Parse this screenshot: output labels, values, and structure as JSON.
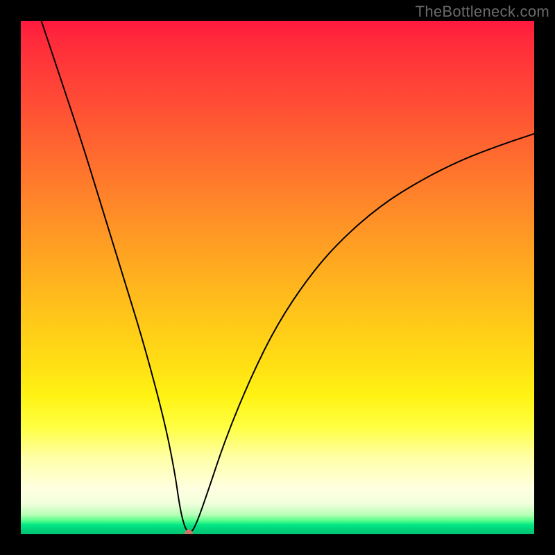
{
  "watermark": "TheBottleneck.com",
  "chart_data": {
    "type": "line",
    "title": "",
    "xlabel": "",
    "ylabel": "",
    "xlim": [
      0,
      100
    ],
    "ylim": [
      0,
      100
    ],
    "series": [
      {
        "name": "bottleneck-curve",
        "x": [
          4,
          8,
          12,
          16,
          20,
          24,
          28,
          30,
          31,
          32,
          33,
          34,
          36,
          40,
          45,
          50,
          56,
          62,
          70,
          78,
          86,
          94,
          100
        ],
        "y": [
          100,
          88,
          76,
          63,
          50,
          37,
          22,
          12,
          5,
          1,
          0.2,
          1.5,
          7,
          19,
          31,
          41,
          50,
          57,
          64,
          69,
          73,
          76,
          78
        ]
      }
    ],
    "marker": {
      "x": 32.7,
      "y": 0.1,
      "color": "#c97864",
      "radius_px": 6
    },
    "background_gradient": {
      "direction": "vertical",
      "stops": [
        {
          "pos": 0.0,
          "color": "#ff193e"
        },
        {
          "pos": 0.37,
          "color": "#ff8b28"
        },
        {
          "pos": 0.67,
          "color": "#ffdf14"
        },
        {
          "pos": 0.85,
          "color": "#ffffa6"
        },
        {
          "pos": 0.97,
          "color": "#5cff8e"
        },
        {
          "pos": 1.0,
          "color": "#00c474"
        }
      ]
    }
  }
}
